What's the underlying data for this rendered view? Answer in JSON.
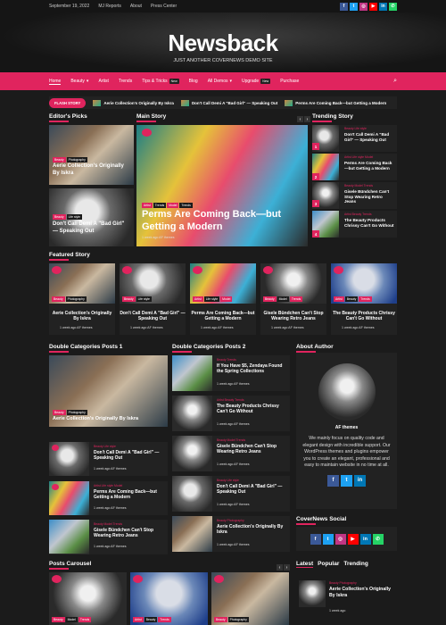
{
  "topbar": {
    "date": "September 19, 2022",
    "links": [
      "MJ Reports",
      "About",
      "Press Center"
    ]
  },
  "social_icons": [
    "facebook-icon",
    "twitter-icon",
    "instagram-icon",
    "youtube-icon",
    "linkedin-icon",
    "whatsapp-icon"
  ],
  "social_colors": [
    "#3b5998",
    "#1da1f2",
    "#c13584",
    "#ff0000",
    "#0077b5",
    "#25d366"
  ],
  "social_glyphs": [
    "f",
    "t",
    "◎",
    "▶",
    "in",
    "✆"
  ],
  "header": {
    "site_title": "Newsback",
    "tagline": "JUST ANOTHER COVERNEWS DEMO SITE"
  },
  "nav": {
    "home": "Home",
    "beauty": "Beauty",
    "artist": "Artist",
    "trends": "Trends",
    "tips": "Tips & Tricks",
    "tips_badge": "New",
    "blog": "Blog",
    "demos": "All Demos",
    "upgrade": "Upgrade",
    "upgrade_badge": "New",
    "purchase": "Purchase"
  },
  "flash": {
    "label": "FLASH STORY",
    "items": [
      "Aerie Collection's Originally By Iskra",
      "Don't Call Demi A \"Bad Girl\" — Speaking Out",
      "Perms Are Coming Back—but Getting a Modern"
    ]
  },
  "sections": {
    "editors": "Editor's Picks",
    "main": "Main Story",
    "trending": "Trending Story",
    "featured": "Featured Story",
    "dbl1": "Double Categories Posts 1",
    "dbl2": "Double Categories Posts 2",
    "about": "About Author",
    "social": "CoverNews Social",
    "carousel": "Posts Carousel",
    "latest": "Latest",
    "popular": "Popular",
    "trending_tab": "Trending"
  },
  "editors": [
    {
      "badges": [
        "Beauty",
        "Photography"
      ],
      "title": "Aerie Collection's Originally By Iskra"
    },
    {
      "badges": [
        "Beauty",
        "Life style"
      ],
      "title": "Don't Call Demi A \"Bad Girl\" — Speaking Out"
    }
  ],
  "main_story": {
    "badges": [
      "Artist",
      "Trends",
      "Model",
      "Trends"
    ],
    "title": "Perms Are Coming Back—but Getting a Modern",
    "meta": "1 week ago  AF themes"
  },
  "common_meta": "1 week ago  AF themes",
  "trending": [
    {
      "num": "1",
      "cat": "Beauty  Life style",
      "title": "Don't Call Demi A \"Bad Girl\" — Speaking Out"
    },
    {
      "num": "2",
      "cat": "Artist  Life style  Model",
      "title": "Perms Are Coming Back—but Getting a Modern"
    },
    {
      "num": "3",
      "cat": "Beauty  Model  Trends",
      "title": "Gisele Bündchen Can't Stop Wearing Retro Jeans"
    },
    {
      "num": "4",
      "cat": "Artist  Beauty  Trends",
      "title": "The Beauty Products Chrissy Can't Go Without"
    }
  ],
  "featured": [
    {
      "badges": [
        "Beauty",
        "Photography"
      ],
      "title": "Aerie Collection's Originally By Iskra"
    },
    {
      "badges": [
        "Beauty",
        "Life style"
      ],
      "title": "Don't Call Demi A \"Bad Girl\" — Speaking Out"
    },
    {
      "badges": [
        "Artist",
        "Life style",
        "Model"
      ],
      "title": "Perms Are Coming Back—but Getting a Modern"
    },
    {
      "badges": [
        "Beauty",
        "Model",
        "Trends"
      ],
      "title": "Gisele Bündchen Can't Stop Wearing Retro Jeans"
    },
    {
      "badges": [
        "Artist",
        "Beauty",
        "Trends"
      ],
      "title": "The Beauty Products Chrissy Can't Go Without"
    }
  ],
  "dbl1": {
    "lead": {
      "badges": [
        "Beauty",
        "Photography"
      ],
      "title": "Aerie Collection's Originally By Iskra"
    },
    "items": [
      {
        "cat": "Beauty  Life style",
        "title": "Don't Call Demi A \"Bad Girl\" — Speaking Out"
      },
      {
        "cat": "Artist  Life style  Model",
        "title": "Perms Are Coming Back—but Getting a Modern"
      },
      {
        "cat": "Beauty  Model  Trends",
        "title": "Gisele Bündchen Can't Stop Wearing Retro Jeans"
      }
    ]
  },
  "dbl2": [
    {
      "cat": "Beauty  Trends",
      "title": "If You Have $5, Zendaya Found the Spring Collections"
    },
    {
      "cat": "Artist  Beauty  Trends",
      "title": "The Beauty Products Chrissy Can't Go Without"
    },
    {
      "cat": "Beauty  Model  Trends",
      "title": "Gisele Bündchen Can't Stop Wearing Retro Jeans"
    },
    {
      "cat": "Beauty  Life style",
      "title": "Don't Call Demi A \"Bad Girl\" — Speaking Out"
    },
    {
      "cat": "Beauty  Photography",
      "title": "Aerie Collection's Originally By Iskra"
    }
  ],
  "author": {
    "name": "AF themes",
    "bio": "We mainly focus on quality code and elegant design with incredible support. Our WordPress themes and plugins empower you to create an elegant, professional and easy to maintain website in no time at all."
  },
  "carousel": [
    {
      "badges": [
        "Beauty",
        "Model",
        "Trends"
      ]
    },
    {
      "badges": [
        "Artist",
        "Beauty",
        "Trends"
      ]
    },
    {
      "badges": [
        "Beauty",
        "Photography"
      ]
    }
  ],
  "latest": {
    "cat": "Beauty  Photography",
    "title": "Aerie Collection's Originally By Iskra",
    "meta": "1 week ago"
  }
}
